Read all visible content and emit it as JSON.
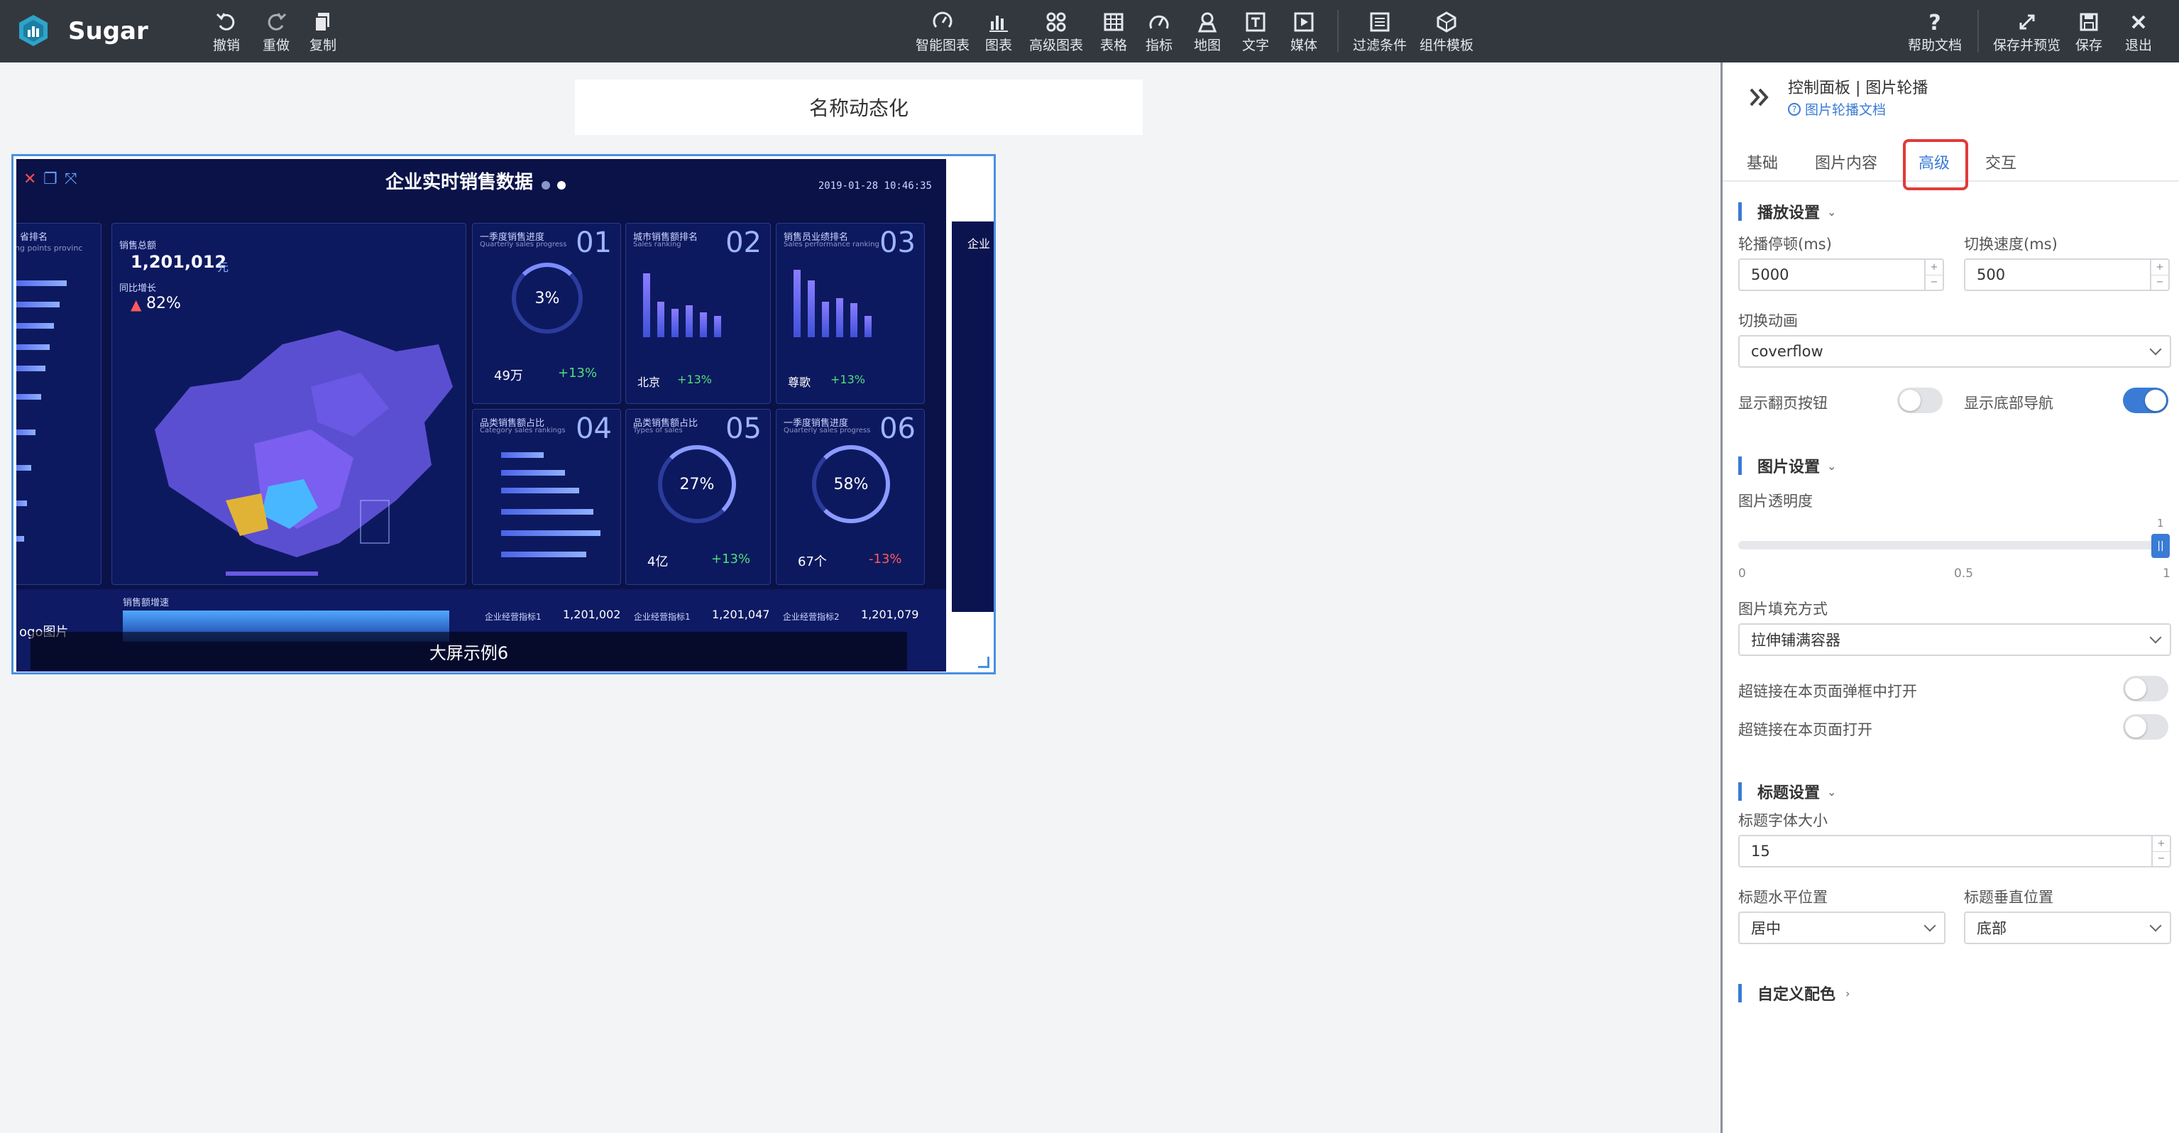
{
  "app": {
    "name": "Sugar"
  },
  "toolbar_left": [
    {
      "label": "撤销",
      "icon": "undo-icon"
    },
    {
      "label": "重做",
      "icon": "redo-icon"
    },
    {
      "label": "复制",
      "icon": "copy-icon"
    }
  ],
  "toolbar_center": [
    {
      "label": "智能图表",
      "icon": "smart-chart-icon"
    },
    {
      "label": "图表",
      "icon": "bar-chart-icon"
    },
    {
      "label": "高级图表",
      "icon": "advanced-chart-icon"
    },
    {
      "label": "表格",
      "icon": "table-icon"
    },
    {
      "label": "指标",
      "icon": "gauge-icon"
    },
    {
      "label": "地图",
      "icon": "map-pin-icon"
    },
    {
      "label": "文字",
      "icon": "text-icon"
    },
    {
      "label": "媒体",
      "icon": "media-icon"
    },
    {
      "label": "过滤条件",
      "icon": "filter-icon"
    },
    {
      "label": "组件模板",
      "icon": "component-template-icon"
    }
  ],
  "toolbar_right": [
    {
      "label": "帮助文档",
      "icon": "help-icon"
    },
    {
      "label": "保存并预览",
      "icon": "expand-icon"
    },
    {
      "label": "保存",
      "icon": "save-icon"
    },
    {
      "label": "退出",
      "icon": "close-icon"
    }
  ],
  "canvas": {
    "title_box": "名称动态化",
    "carousel": {
      "caption": "大屏示例6",
      "dashboard": {
        "title": "企业实时销售数据",
        "timestamp": "2019-01-28 10:46:35",
        "total_label": "销售总额",
        "total_value": "1,201,012",
        "total_unit": "元",
        "growth_label": "同比增长",
        "growth_value": "82%",
        "left_label": "省排名",
        "left_sub": "ing points provinc",
        "logo_text": "ogo图片",
        "panels": [
          {
            "num": "01",
            "title": "一季度销售进度",
            "sub": "Quarterly sales progress",
            "gauge": "3%",
            "left": "49万",
            "right": "+13%"
          },
          {
            "num": "02",
            "title": "城市销售额排名",
            "sub": "Sales ranking",
            "left": "北京",
            "right": "+13%"
          },
          {
            "num": "03",
            "title": "销售员业绩排名",
            "sub": "Sales performance ranking",
            "left": "尊歌",
            "right": "+13%"
          },
          {
            "num": "04",
            "title": "品类销售额占比",
            "sub": "Category sales rankings"
          },
          {
            "num": "05",
            "title": "品类销售额占比",
            "sub": "Types of sales",
            "gauge": "27%",
            "left": "4亿",
            "right": "+13%"
          },
          {
            "num": "06",
            "title": "一季度销售进度",
            "sub": "Quarterly sales progress",
            "gauge": "58%",
            "left": "67个",
            "right": "-13%"
          }
        ],
        "bottom_label": "销售额增速",
        "bottom_metrics": [
          {
            "label": "企业经营指标1",
            "value": "1,201,002"
          },
          {
            "label": "企业经营指标1",
            "value": "1,201,047"
          },
          {
            "label": "企业经营指标2",
            "value": "1,201,079"
          }
        ],
        "side_text": "企业"
      }
    }
  },
  "panel": {
    "title": "控制面板 | 图片轮播",
    "doc_link": "图片轮播文档",
    "tabs": [
      "基础",
      "图片内容",
      "高级",
      "交互"
    ],
    "active_tab": "高级",
    "play": {
      "section": "播放设置",
      "pause_label": "轮播停顿(ms)",
      "pause_value": "5000",
      "speed_label": "切换速度(ms)",
      "speed_value": "500",
      "anim_label": "切换动画",
      "anim_value": "coverflow",
      "show_pager_label": "显示翻页按钮",
      "show_pager": false,
      "show_nav_label": "显示底部导航",
      "show_nav": true
    },
    "image": {
      "section": "图片设置",
      "opacity_label": "图片透明度",
      "opacity_value": "1",
      "opacity_ticks": [
        "0",
        "0.5",
        "1"
      ],
      "fill_label": "图片填充方式",
      "fill_value": "拉伸铺满容器",
      "link_popup_label": "超链接在本页面弹框中打开",
      "link_popup": false,
      "link_self_label": "超链接在本页面打开",
      "link_self": false
    },
    "title_settings": {
      "section": "标题设置",
      "font_label": "标题字体大小",
      "font_value": "15",
      "h_label": "标题水平位置",
      "h_value": "居中",
      "v_label": "标题垂直位置",
      "v_value": "底部"
    },
    "color": {
      "section": "自定义配色"
    }
  },
  "colors": {
    "accent": "#3a7bd5",
    "topbar": "#33383f",
    "highlight": "#e23a3a",
    "dashboard_bg": "#0a1248"
  }
}
